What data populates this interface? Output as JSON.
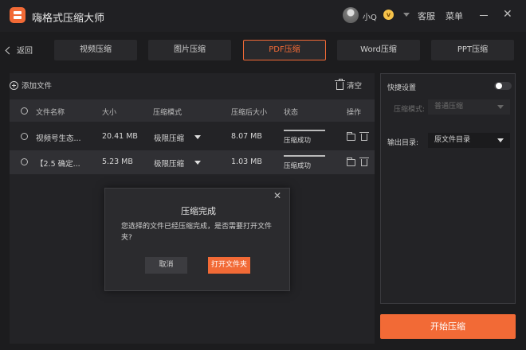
{
  "app": {
    "title": "嗨格式压缩大师"
  },
  "user": {
    "name": "小Q",
    "badge": "v"
  },
  "header": {
    "service": "客服",
    "menu": "菜单"
  },
  "nav": {
    "back": "返回"
  },
  "tabs": [
    {
      "label": "视频压缩"
    },
    {
      "label": "图片压缩"
    },
    {
      "label": "PDF压缩"
    },
    {
      "label": "Word压缩"
    },
    {
      "label": "PPT压缩"
    }
  ],
  "toolbar": {
    "add_file": "添加文件",
    "clear": "清空"
  },
  "table": {
    "headers": [
      "文件名称",
      "大小",
      "压缩模式",
      "压缩后大小",
      "状态",
      "操作"
    ],
    "rows": [
      {
        "name": "视频号生态...",
        "size": "20.41 MB",
        "mode": "极限压缩",
        "after": "8.07 MB",
        "status": "压缩成功"
      },
      {
        "name": "【2.5 确定...",
        "size": "5.23 MB",
        "mode": "极限压缩",
        "after": "1.03 MB",
        "status": "压缩成功"
      }
    ]
  },
  "settings": {
    "quick_label": "快捷设置",
    "mode_label": "压缩模式:",
    "mode_value": "普通压缩",
    "output_label": "输出目录:",
    "output_value": "原文件目录"
  },
  "actions": {
    "start": "开始压缩"
  },
  "dialog": {
    "title": "压缩完成",
    "message": "您选择的文件已经压缩完成，是否需要打开文件夹?",
    "cancel": "取消",
    "open": "打开文件夹"
  },
  "colors": {
    "accent": "#f26a36",
    "background": "#1c1c1e",
    "panel": "#232326"
  }
}
